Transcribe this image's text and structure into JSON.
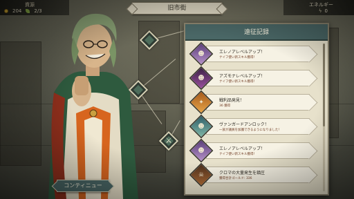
{
  "top_bar": {
    "resources_label": "資源",
    "gold": "204",
    "herbs": "2/3",
    "energy_label": "エネルギー",
    "energy": "0",
    "location": "旧市街"
  },
  "icons": {
    "gold": "coin-icon",
    "herbs": "leaf-icon",
    "energy": "bolt-icon",
    "node_crossed_swords": "crossed-swords-icon"
  },
  "panel": {
    "title": "遠征記録",
    "entries": [
      {
        "title": "エレノアレベルアップ！",
        "detail": "ナイフ使い新スキル獲得！",
        "portrait": "eleanor-portrait"
      },
      {
        "title": "アズモナレベルアップ！",
        "detail": "ナイフ使い新スキル獲得！",
        "portrait": "azmona-portrait"
      },
      {
        "title": "戦利品発見！",
        "detail": "36 獲得",
        "portrait": "loot-icon"
      },
      {
        "title": "ヴァンガードアンロック！",
        "detail": "一族が議員を加護できるようになりました！",
        "portrait": "vanguard-portrait"
      },
      {
        "title": "エレノアレベルアップ！",
        "detail": "ナイフ使い新スキル獲得！",
        "portrait": "eleanor-portrait"
      },
      {
        "title": "クロマの大量発生を鎮圧",
        "detail": "獲得合計ゴールド: 336",
        "portrait": "skull-icon"
      }
    ]
  },
  "continue_label": "コンティニュー",
  "colors": {
    "panel_header": "#4a6766",
    "panel_bg": "#e7e1cb",
    "gold": "#e2b93b"
  }
}
